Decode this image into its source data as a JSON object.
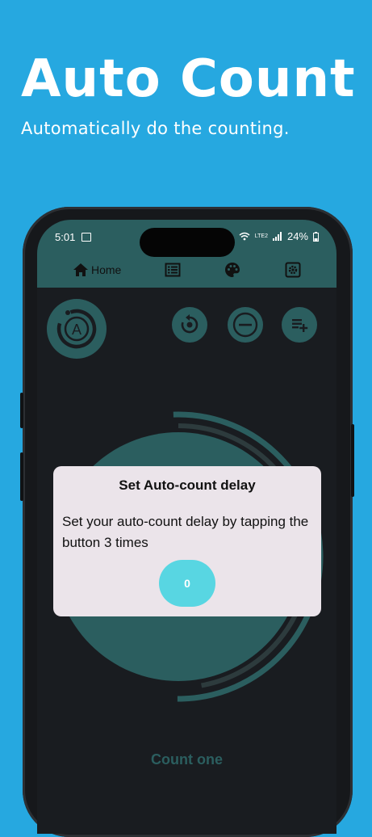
{
  "promo": {
    "title": "Auto Count",
    "subtitle": "Automatically do the counting."
  },
  "status_bar": {
    "time": "5:01",
    "battery": "24%",
    "network": "LTE2"
  },
  "tabs": [
    {
      "label": "Home",
      "icon": "home-icon"
    },
    {
      "label": "",
      "icon": "list-icon"
    },
    {
      "label": "",
      "icon": "palette-icon"
    },
    {
      "label": "",
      "icon": "settings-icon"
    }
  ],
  "toolbar": {
    "logo_letter": "A",
    "icons": [
      "reset-icon",
      "minus-icon",
      "add-playlist-icon"
    ]
  },
  "counter": {
    "name": "Count one"
  },
  "dialog": {
    "title": "Set Auto-count delay",
    "message": "Set your auto-count delay by tapping the button 3 times",
    "button_value": "0"
  },
  "colors": {
    "background": "#26a8e0",
    "teal": "#2b5e5f",
    "screen": "#191c20",
    "dialog": "#ebe4ea",
    "accent": "#58d6e2"
  }
}
